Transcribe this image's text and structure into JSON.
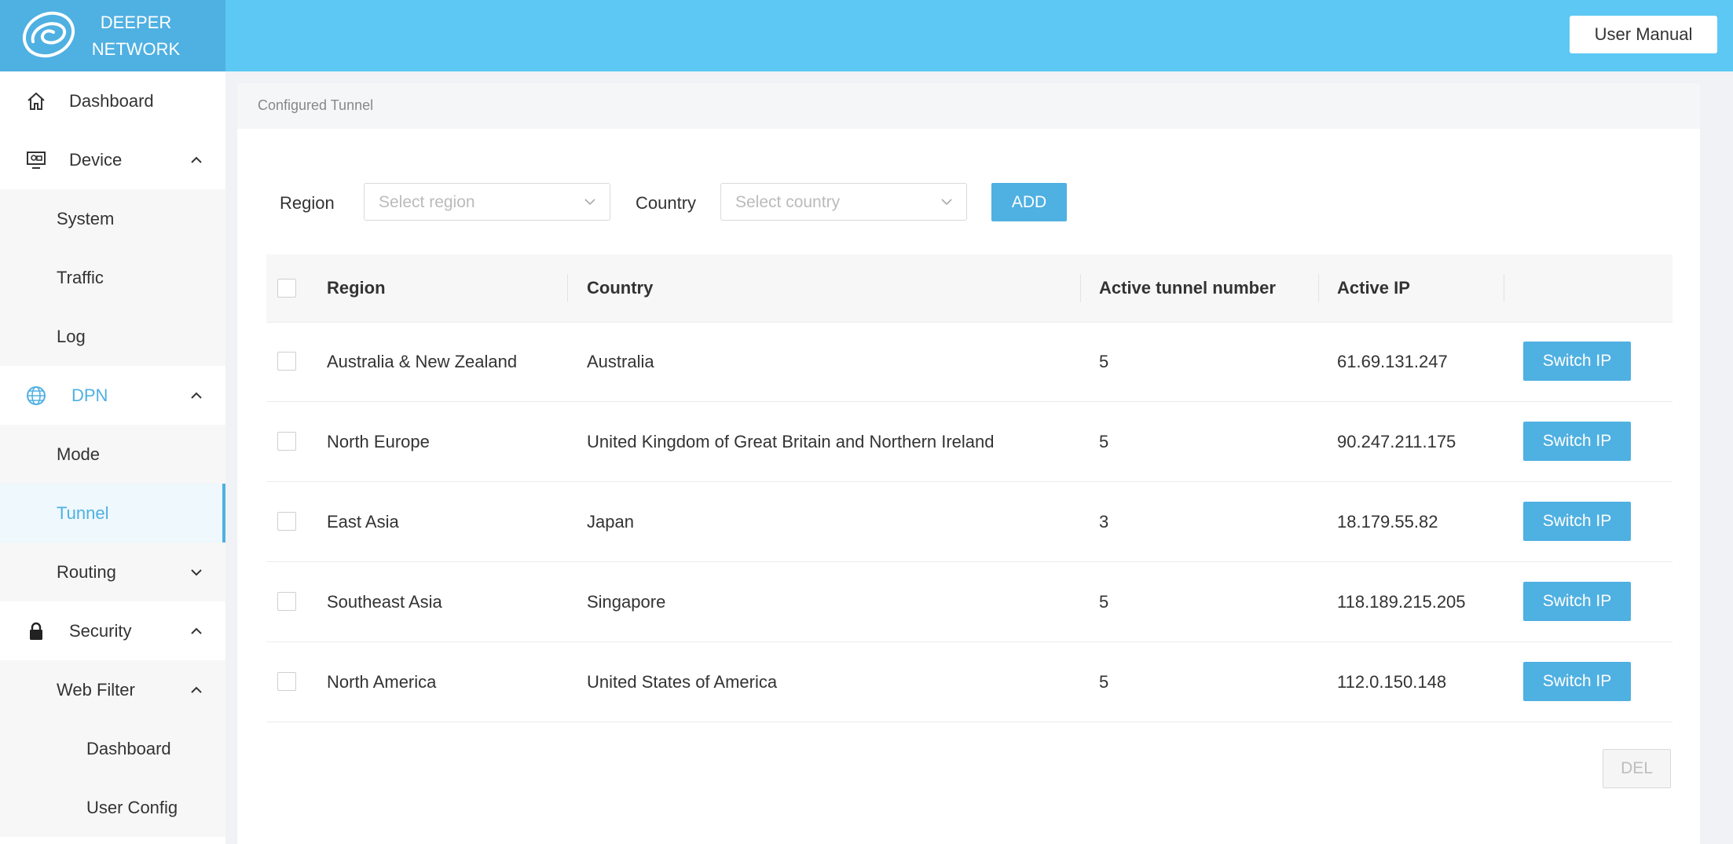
{
  "app": {
    "brand_line1": "DEEPER",
    "brand_line2": "NETWORK",
    "user_manual": "User Manual"
  },
  "colors": {
    "header": "#5dc8f3",
    "logo_bg": "#4fb0e2",
    "accent": "#4fb0e2"
  },
  "sidebar": {
    "dashboard": "Dashboard",
    "device": "Device",
    "system": "System",
    "traffic": "Traffic",
    "log": "Log",
    "dpn": "DPN",
    "mode": "Mode",
    "tunnel": "Tunnel",
    "routing": "Routing",
    "security": "Security",
    "web_filter": "Web Filter",
    "wf_dashboard": "Dashboard",
    "user_config": "User Config"
  },
  "breadcrumb": "Configured Tunnel",
  "filters": {
    "region_label": "Region",
    "region_placeholder": "Select region",
    "country_label": "Country",
    "country_placeholder": "Select country",
    "add_label": "ADD"
  },
  "table": {
    "headers": {
      "region": "Region",
      "country": "Country",
      "active_tunnels": "Active tunnel number",
      "active_ip": "Active IP"
    },
    "switch_label": "Switch IP",
    "rows": [
      {
        "region": "Australia & New Zealand",
        "country": "Australia",
        "tunnels": "5",
        "ip": "61.69.131.247"
      },
      {
        "region": "North Europe",
        "country": "United Kingdom of Great Britain and Northern Ireland",
        "tunnels": "5",
        "ip": "90.247.211.175"
      },
      {
        "region": "East Asia",
        "country": "Japan",
        "tunnels": "3",
        "ip": "18.179.55.82"
      },
      {
        "region": "Southeast Asia",
        "country": "Singapore",
        "tunnels": "5",
        "ip": "118.189.215.205"
      },
      {
        "region": "North America",
        "country": "United States of America",
        "tunnels": "5",
        "ip": "112.0.150.148"
      }
    ],
    "del_label": "DEL"
  }
}
